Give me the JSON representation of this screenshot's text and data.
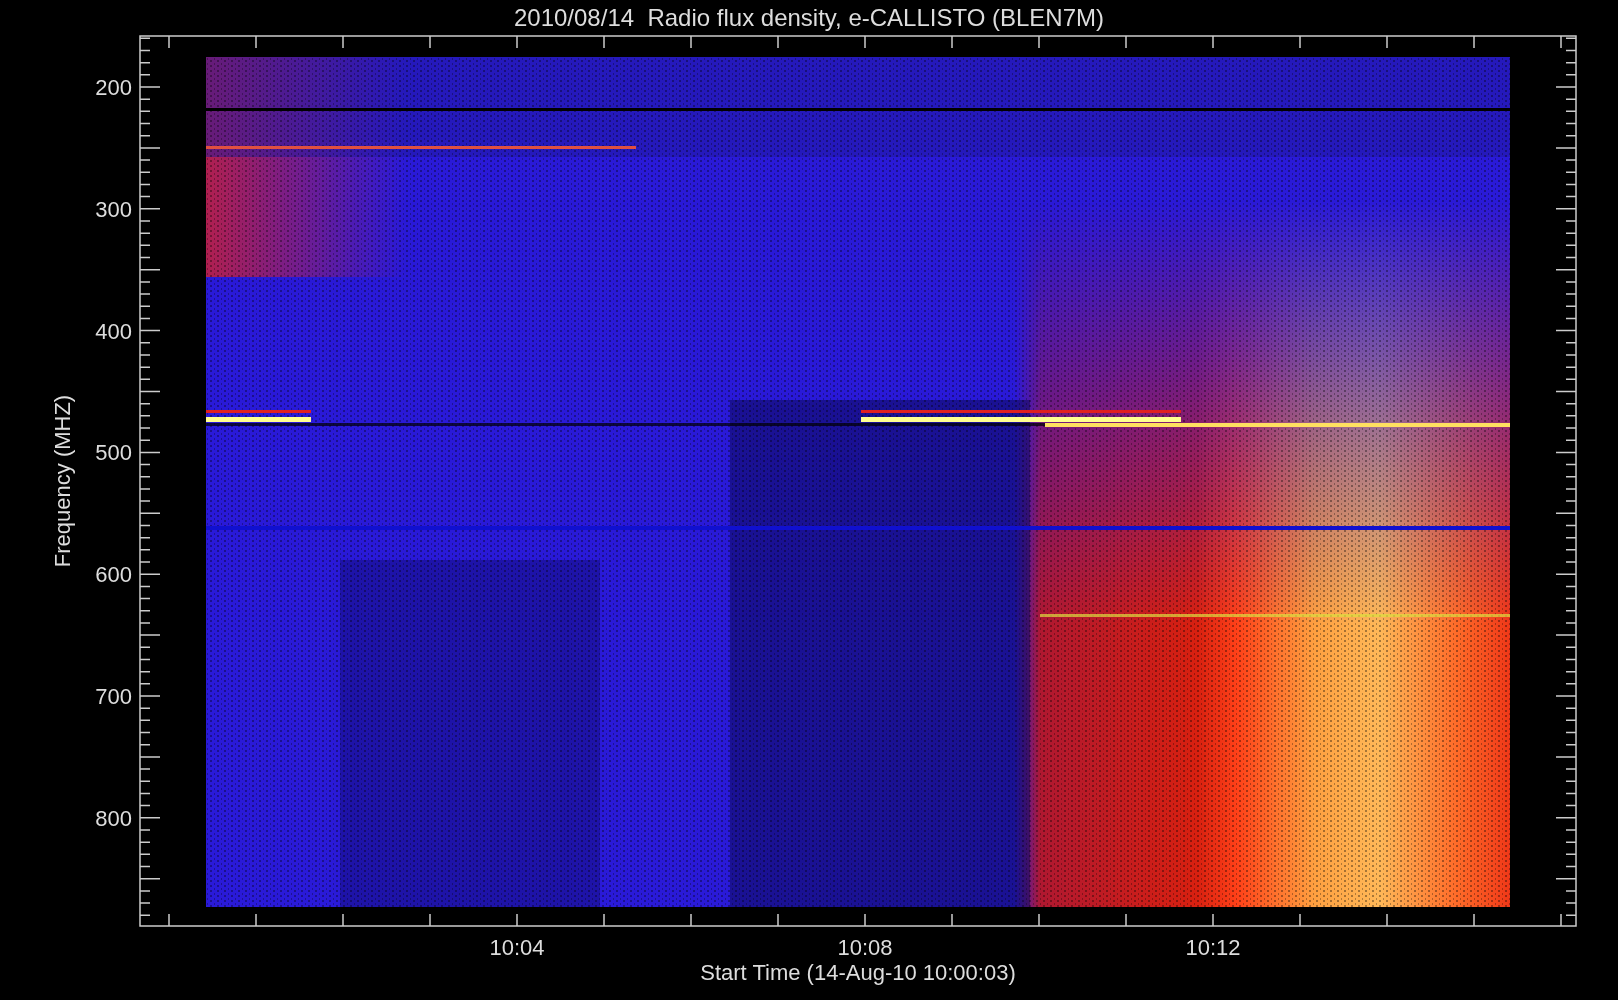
{
  "title": "2010/08/14  Radio flux density, e-CALLISTO (BLEN7M)",
  "y_axis": {
    "label": "Frequency (MHZ)",
    "ticks": [
      "200",
      "300",
      "400",
      "500",
      "600",
      "700",
      "800"
    ]
  },
  "x_axis": {
    "label": "Start Time (14-Aug-10 10:00:03)",
    "ticks": [
      "10:04",
      "10:08",
      "10:12"
    ]
  }
}
